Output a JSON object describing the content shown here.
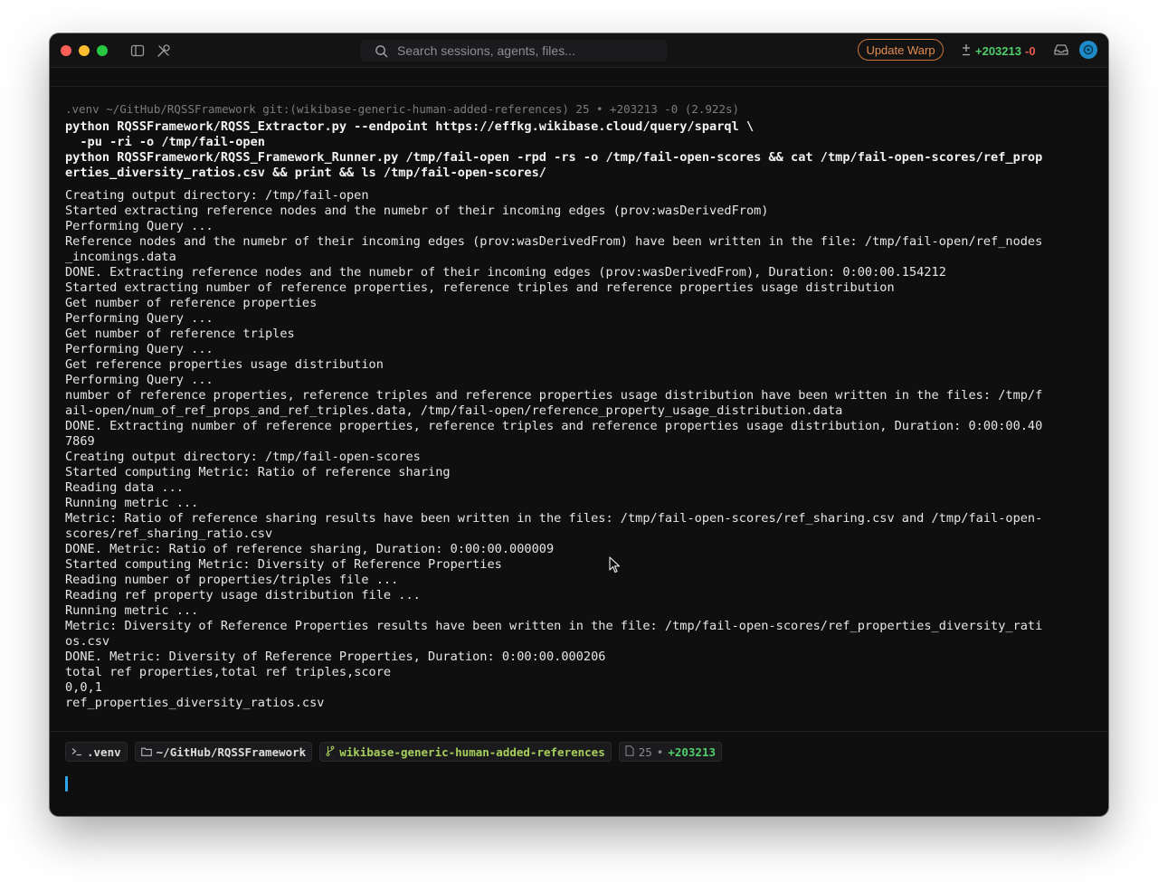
{
  "titlebar": {
    "search_placeholder": "Search sessions, agents, files...",
    "update_button": "Update Warp",
    "diff_added": "+203213",
    "diff_removed": "-0",
    "icons": [
      "sidebar-toggle-icon",
      "tools-icon",
      "search-icon",
      "diff-icon",
      "inbox-icon",
      "avatar-icon"
    ]
  },
  "terminal": {
    "prompt": ".venv ~/GitHub/RQSSFramework git:(wikibase-generic-human-added-references) 25 • +203213 -0 (2.922s)",
    "command_lines": [
      "python RQSSFramework/RQSS_Extractor.py --endpoint https://effkg.wikibase.cloud/query/sparql \\",
      "  -pu -ri -o /tmp/fail-open",
      "python RQSSFramework/RQSS_Framework_Runner.py /tmp/fail-open -rpd -rs -o /tmp/fail-open-scores && cat /tmp/fail-open-scores/ref_prop",
      "erties_diversity_ratios.csv && print && ls /tmp/fail-open-scores/"
    ],
    "output_lines": [
      "Creating output directory: /tmp/fail-open",
      "Started extracting reference nodes and the numebr of their incoming edges (prov:wasDerivedFrom)",
      "Performing Query ...",
      "Reference nodes and the numebr of their incoming edges (prov:wasDerivedFrom) have been written in the file: /tmp/fail-open/ref_nodes",
      "_incomings.data",
      "DONE. Extracting reference nodes and the numebr of their incoming edges (prov:wasDerivedFrom), Duration: 0:00:00.154212",
      "Started extracting number of reference properties, reference triples and reference properties usage distribution",
      "Get number of reference properties",
      "Performing Query ...",
      "Get number of reference triples",
      "Performing Query ...",
      "Get reference properties usage distribution",
      "Performing Query ...",
      "number of reference properties, reference triples and reference properties usage distribution have been written in the files: /tmp/f",
      "ail-open/num_of_ref_props_and_ref_triples.data, /tmp/fail-open/reference_property_usage_distribution.data",
      "DONE. Extracting number of reference properties, reference triples and reference properties usage distribution, Duration: 0:00:00.40",
      "7869",
      "Creating output directory: /tmp/fail-open-scores",
      "Started computing Metric: Ratio of reference sharing",
      "Reading data ...",
      "Running metric ...",
      "Metric: Ratio of reference sharing results have been written in the files: /tmp/fail-open-scores/ref_sharing.csv and /tmp/fail-open-",
      "scores/ref_sharing_ratio.csv",
      "DONE. Metric: Ratio of reference sharing, Duration: 0:00:00.000009",
      "Started computing Metric: Diversity of Reference Properties",
      "Reading number of properties/triples file ...",
      "Reading ref property usage distribution file ...",
      "Running metric ...",
      "Metric: Diversity of Reference Properties results have been written in the file: /tmp/fail-open-scores/ref_properties_diversity_rati",
      "os.csv",
      "DONE. Metric: Diversity of Reference Properties, Duration: 0:00:00.000206",
      "total ref properties,total ref triples,score",
      "0,0,1",
      "ref_properties_diversity_ratios.csv"
    ]
  },
  "statusbar": {
    "venv": ".venv",
    "directory": "~/GitHub/RQSSFramework",
    "branch": "wikibase-generic-human-added-references",
    "files_changed": "25",
    "separator": "•",
    "lines_added": "+203213"
  }
}
